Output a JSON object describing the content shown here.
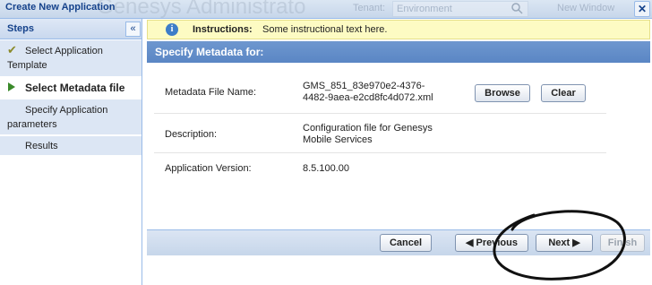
{
  "titlebar": {
    "title": "Create New Application",
    "background_text": "Genesys Administrato",
    "tenant_label": "Tenant:",
    "tenant_value": "Environment",
    "new_window": "New Window",
    "close_icon": "close-icon"
  },
  "sidebar": {
    "title": "Steps",
    "collapse_icon": "double-chevron-left-icon",
    "steps": [
      {
        "label": "Select Application Template",
        "state": "done",
        "icon": "checkmark-icon"
      },
      {
        "label": "Select Metadata file",
        "state": "current",
        "icon": "arrow-right-icon"
      },
      {
        "label": "Specify Application parameters",
        "state": "pending"
      },
      {
        "label": "Results",
        "state": "pending"
      }
    ]
  },
  "instructions": {
    "label": "Instructions:",
    "text": "Some instructional text here.",
    "icon": "info-icon"
  },
  "panel": {
    "title": "Specify Metadata for:",
    "rows": [
      {
        "label": "Metadata File Name:",
        "value": "GMS_851_83e970e2-4376-4482-9aea-e2cd8fc4d072.xml"
      },
      {
        "label": "Description:",
        "value": "Configuration file for Genesys Mobile Services"
      },
      {
        "label": "Application Version:",
        "value": "8.5.100.00"
      }
    ],
    "browse_label": "Browse",
    "clear_label": "Clear"
  },
  "footer": {
    "cancel_label": "Cancel",
    "previous_label": "◀ Previous",
    "next_label": "Next ▶",
    "finish_label": "Finish"
  },
  "colors": {
    "accent": "#5a86c4",
    "title_text": "#15428b",
    "instruction_bg": "#fdfbc3"
  }
}
